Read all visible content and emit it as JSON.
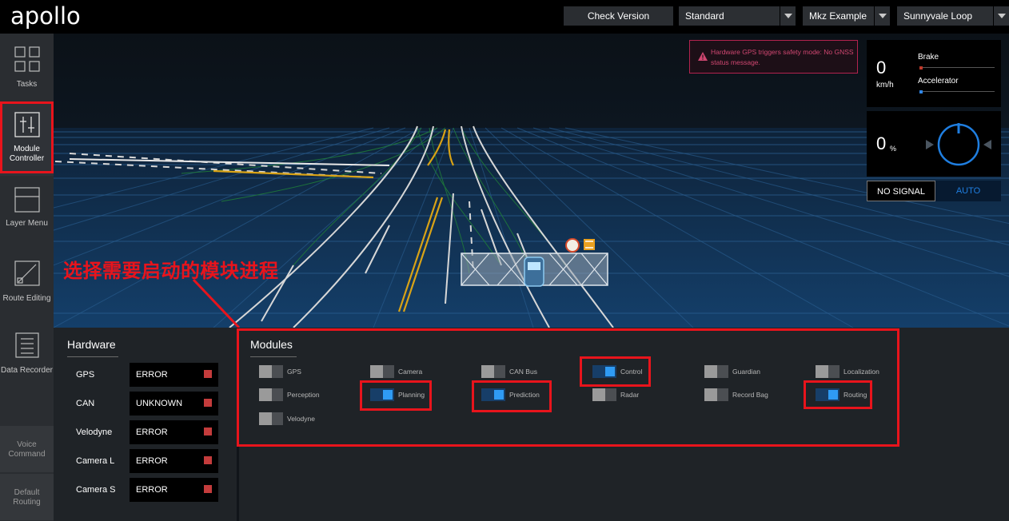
{
  "header": {
    "logo": "apollo",
    "check_version": "Check Version",
    "mode_select": "Standard",
    "vehicle_select": "Mkz Example",
    "map_select": "Sunnyvale Loop"
  },
  "sidenav": {
    "items": [
      {
        "label": "Tasks",
        "icon": "tasks-grid-icon"
      },
      {
        "label": "Module Controller",
        "icon": "sliders-icon"
      },
      {
        "label": "Layer Menu",
        "icon": "layer-icon"
      },
      {
        "label": "Route Editing",
        "icon": "route-edit-icon"
      },
      {
        "label": "Data Recorder",
        "icon": "document-icon"
      }
    ],
    "voice_command": "Voice Command",
    "default_routing": "Default Routing"
  },
  "alert": {
    "text": "Hardware GPS triggers safety mode: No GNSS status message."
  },
  "dashboard": {
    "speed": "0",
    "speed_unit": "km/h",
    "brake_label": "Brake",
    "accelerator_label": "Accelerator",
    "brake_level": 0,
    "accelerator_level": 0,
    "steering": "0",
    "steering_unit": "%",
    "signal": "NO SIGNAL",
    "driving_mode": "AUTO",
    "brake_color": "#c0392b",
    "accelerator_color": "#2f86e8"
  },
  "annotation": "选择需要启动的模块进程",
  "hardware": {
    "title": "Hardware",
    "rows": [
      {
        "name": "GPS",
        "status": "ERROR"
      },
      {
        "name": "CAN",
        "status": "UNKNOWN"
      },
      {
        "name": "Velodyne",
        "status": "ERROR"
      },
      {
        "name": "Camera L",
        "status": "ERROR"
      },
      {
        "name": "Camera S",
        "status": "ERROR"
      }
    ]
  },
  "modules": {
    "title": "Modules",
    "items": [
      {
        "label": "GPS",
        "on": false
      },
      {
        "label": "Camera",
        "on": false
      },
      {
        "label": "CAN Bus",
        "on": false
      },
      {
        "label": "Control",
        "on": true
      },
      {
        "label": "Guardian",
        "on": false
      },
      {
        "label": "Localization",
        "on": false
      },
      {
        "label": "Perception",
        "on": false
      },
      {
        "label": "Planning",
        "on": true
      },
      {
        "label": "Prediction",
        "on": true
      },
      {
        "label": "Radar",
        "on": false
      },
      {
        "label": "Record Bag",
        "on": false
      },
      {
        "label": "Routing",
        "on": true
      },
      {
        "label": "Velodyne",
        "on": false
      }
    ]
  }
}
